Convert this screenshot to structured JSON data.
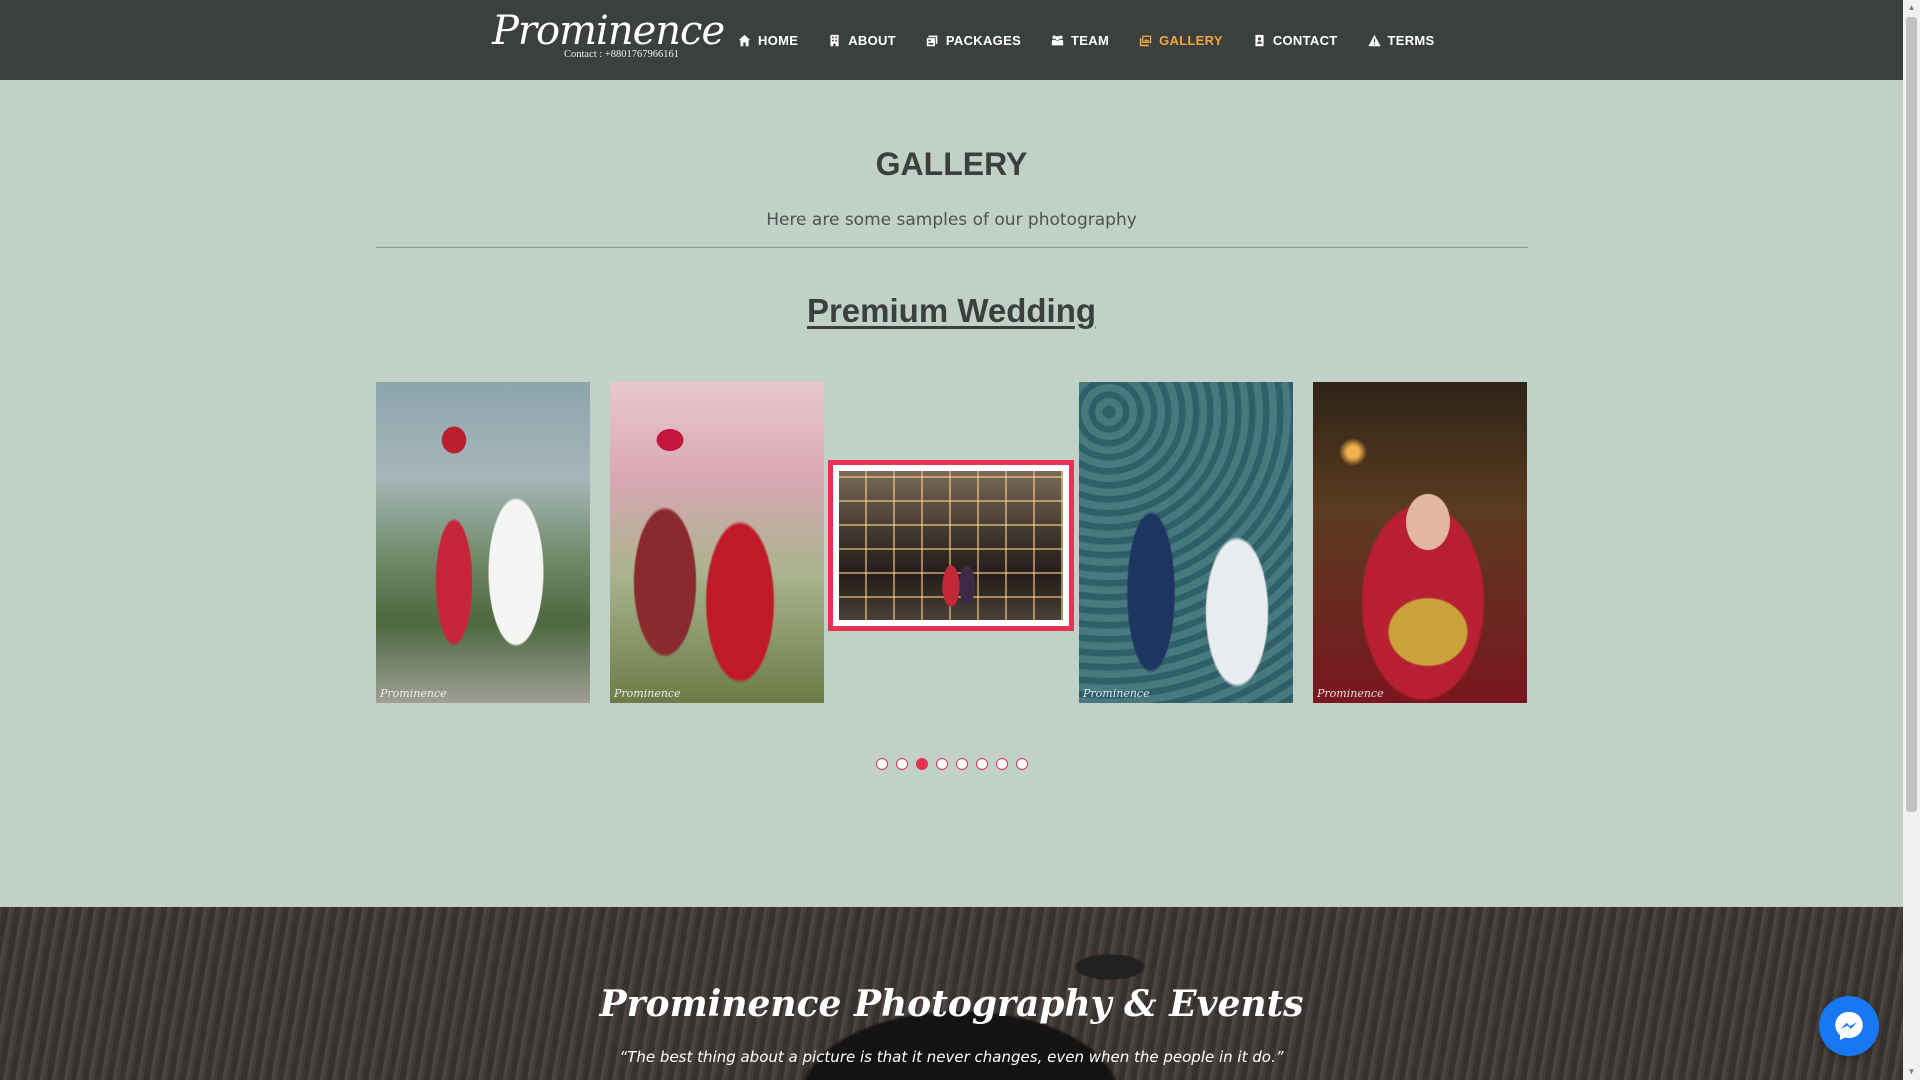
{
  "header": {
    "logo_text": "Prominence",
    "logo_contact": "Contact : +8801767966161",
    "nav": [
      {
        "label": "HOME",
        "icon": "home-icon"
      },
      {
        "label": "ABOUT",
        "icon": "building-icon"
      },
      {
        "label": "PACKAGES",
        "icon": "packages-icon"
      },
      {
        "label": "TEAM",
        "icon": "team-icon"
      },
      {
        "label": "GALLERY",
        "icon": "gallery-icon",
        "active": true
      },
      {
        "label": "CONTACT",
        "icon": "contact-card-icon"
      },
      {
        "label": "TERMS",
        "icon": "warning-icon"
      }
    ],
    "active_color": "#f0a83c"
  },
  "gallery": {
    "title": "GALLERY",
    "subtitle": "Here are some samples of our photography",
    "section_title": "Premium Wedding",
    "watermark": "Prominence",
    "carousel": {
      "slide_count": 8,
      "active_index": 3,
      "accent_color": "#e53353"
    }
  },
  "footer": {
    "title": "Prominence Photography & Events",
    "quote": "“The best thing about a picture is that it never changes, even when the people in it do.”"
  },
  "messenger": {
    "icon": "messenger-icon",
    "color": "#1877f2"
  }
}
